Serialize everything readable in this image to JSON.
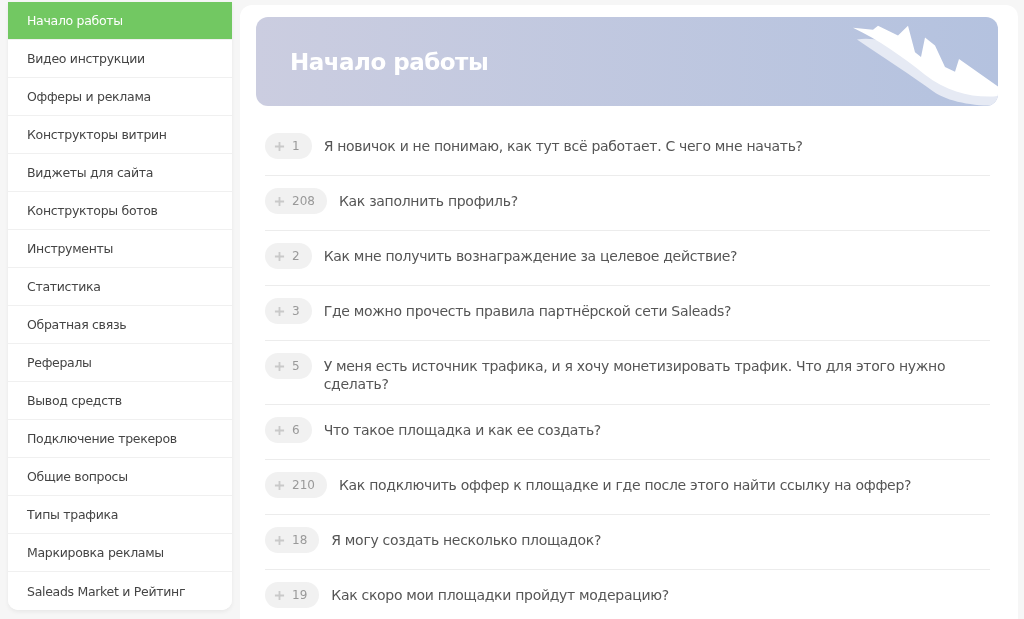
{
  "sidebar": {
    "items": [
      {
        "label": "Начало работы",
        "selected": true
      },
      {
        "label": "Видео инструкции",
        "selected": false
      },
      {
        "label": "Офферы и реклама",
        "selected": false
      },
      {
        "label": "Конструкторы витрин",
        "selected": false
      },
      {
        "label": "Виджеты для сайта",
        "selected": false
      },
      {
        "label": "Конструкторы ботов",
        "selected": false
      },
      {
        "label": "Инструменты",
        "selected": false
      },
      {
        "label": "Статистика",
        "selected": false
      },
      {
        "label": "Обратная связь",
        "selected": false
      },
      {
        "label": "Рефералы",
        "selected": false
      },
      {
        "label": "Вывод средств",
        "selected": false
      },
      {
        "label": "Подключение трекеров",
        "selected": false
      },
      {
        "label": "Общие вопросы",
        "selected": false
      },
      {
        "label": "Типы трафика",
        "selected": false
      },
      {
        "label": "Маркировка рекламы",
        "selected": false
      },
      {
        "label": "Saleads Market и Рейтинг",
        "selected": false
      }
    ]
  },
  "banner": {
    "title": "Начало работы"
  },
  "questions": [
    {
      "count": "1",
      "text": "Я новичок и не понимаю, как тут всё работает. С чего мне начать?"
    },
    {
      "count": "208",
      "text": "Как заполнить профиль?"
    },
    {
      "count": "2",
      "text": "Как мне получить вознаграждение за целевое действие?"
    },
    {
      "count": "3",
      "text": "Где можно прочесть правила партнёрской сети Saleads?"
    },
    {
      "count": "5",
      "text": "У меня есть источник трафика, и я хочу монетизировать трафик. Что для этого нужно сделать?"
    },
    {
      "count": "6",
      "text": "Что такое площадка и как ее создать?"
    },
    {
      "count": "210",
      "text": "Как подключить оффер к площадке и где после этого найти ссылку на оффер?"
    },
    {
      "count": "18",
      "text": "Я могу создать несколько площадок?"
    },
    {
      "count": "19",
      "text": "Как скоро мои площадки пройдут модерацию?"
    }
  ]
}
